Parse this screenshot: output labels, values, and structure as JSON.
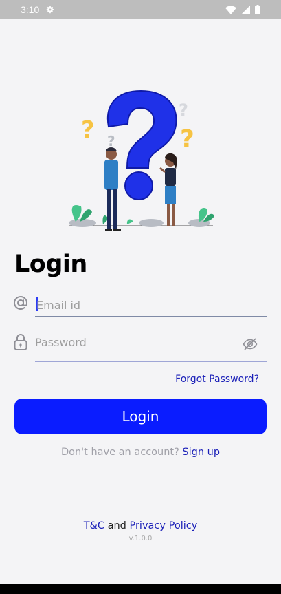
{
  "status_bar": {
    "time": "3:10"
  },
  "login": {
    "title": "Login",
    "email_placeholder": "Email id",
    "password_placeholder": "Password",
    "forgot_password": "Forgot Password?",
    "button_label": "Login",
    "no_account_text": "Don't have an account?",
    "signup_link": "Sign up"
  },
  "footer": {
    "tc": "T&C",
    "and": "and",
    "privacy": "Privacy Policy",
    "version": "v.1.0.0"
  },
  "colors": {
    "accent": "#0a1cff",
    "link": "#1a1fb8",
    "question_yellow": "#f6c343"
  },
  "icons": {
    "email": "at-sign-icon",
    "password": "lock-icon",
    "visibility": "eye-off-icon"
  }
}
